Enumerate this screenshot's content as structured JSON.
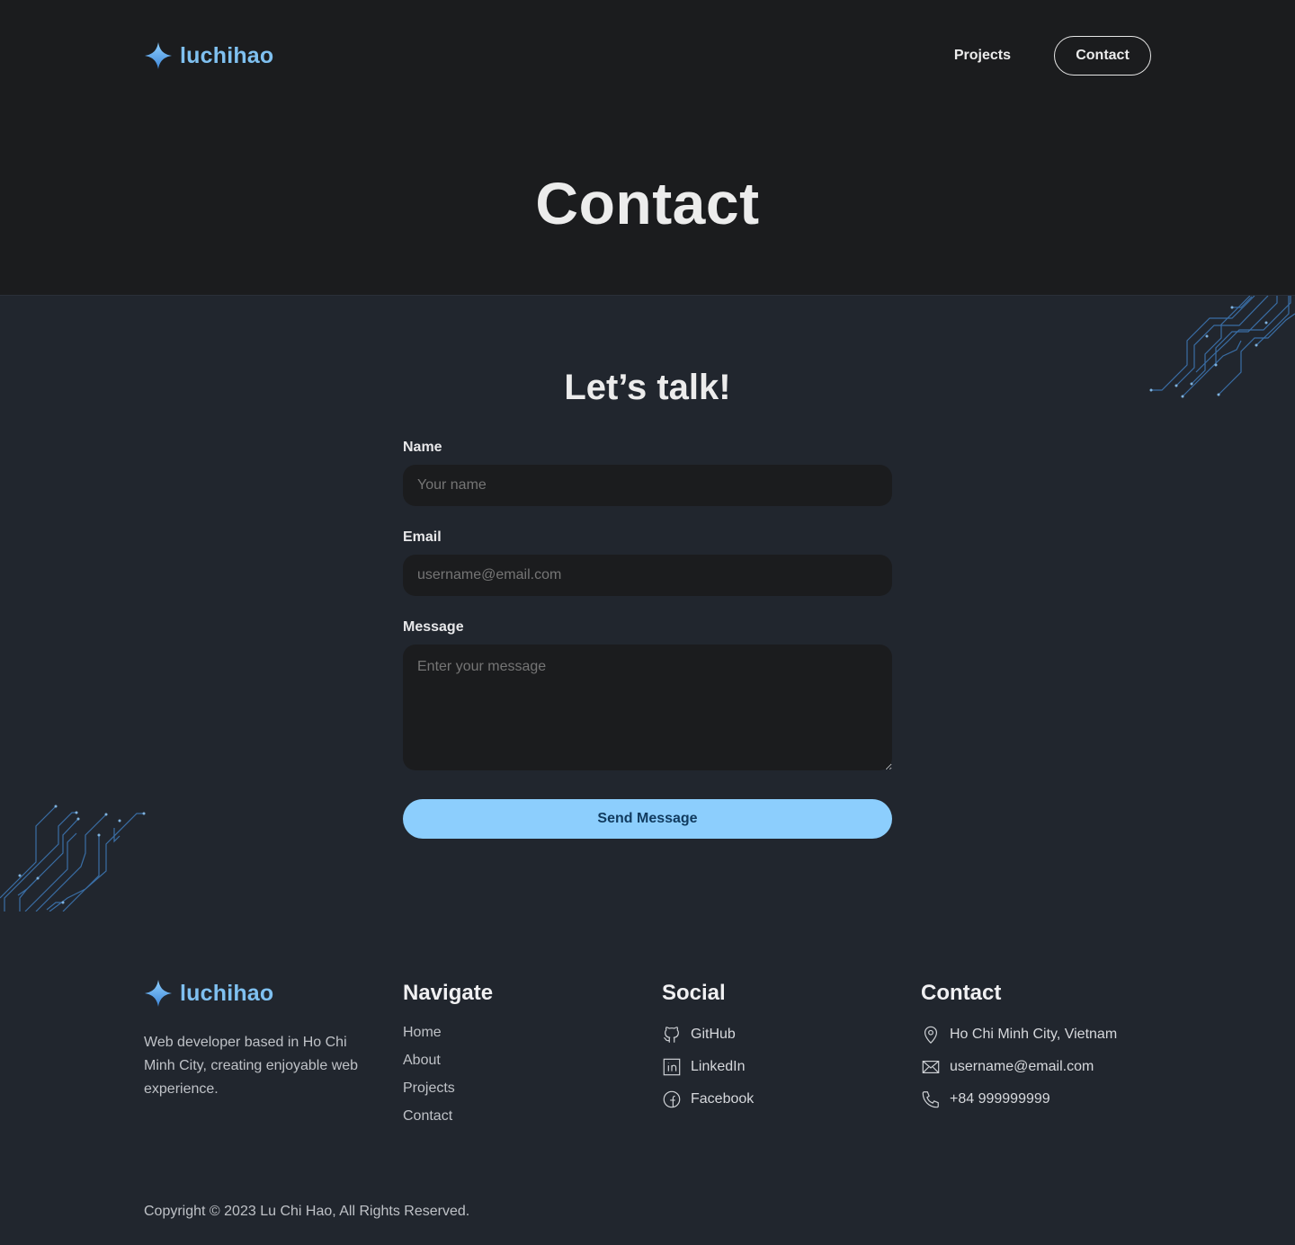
{
  "brand": {
    "name": "luchihao",
    "color": "#7fc0f0"
  },
  "nav": {
    "links": [
      {
        "label": "Projects"
      }
    ],
    "cta": "Contact"
  },
  "hero": {
    "title": "Contact"
  },
  "form": {
    "heading": "Let’s talk!",
    "name": {
      "label": "Name",
      "placeholder": "Your name"
    },
    "email": {
      "label": "Email",
      "placeholder": "username@email.com"
    },
    "message": {
      "label": "Message",
      "placeholder": "Enter your message"
    },
    "submit": "Send Message",
    "accent": "#8ccefd"
  },
  "footer": {
    "brand": "luchihao",
    "description": "Web developer based in Ho Chi Minh City, creating enjoyable web experience.",
    "navigate": {
      "heading": "Navigate",
      "items": [
        "Home",
        "About",
        "Projects",
        "Contact"
      ]
    },
    "social": {
      "heading": "Social",
      "items": [
        {
          "icon": "github-icon",
          "label": "GitHub"
        },
        {
          "icon": "linkedin-icon",
          "label": "LinkedIn"
        },
        {
          "icon": "facebook-icon",
          "label": "Facebook"
        }
      ]
    },
    "contact": {
      "heading": "Contact",
      "items": [
        {
          "icon": "location-pin-icon",
          "label": "Ho Chi Minh City, Vietnam"
        },
        {
          "icon": "mail-icon",
          "label": "username@email.com"
        },
        {
          "icon": "phone-icon",
          "label": "+84 999999999"
        }
      ]
    },
    "copyright": "Copyright © 2023 Lu Chi Hao, All Rights Reserved."
  }
}
